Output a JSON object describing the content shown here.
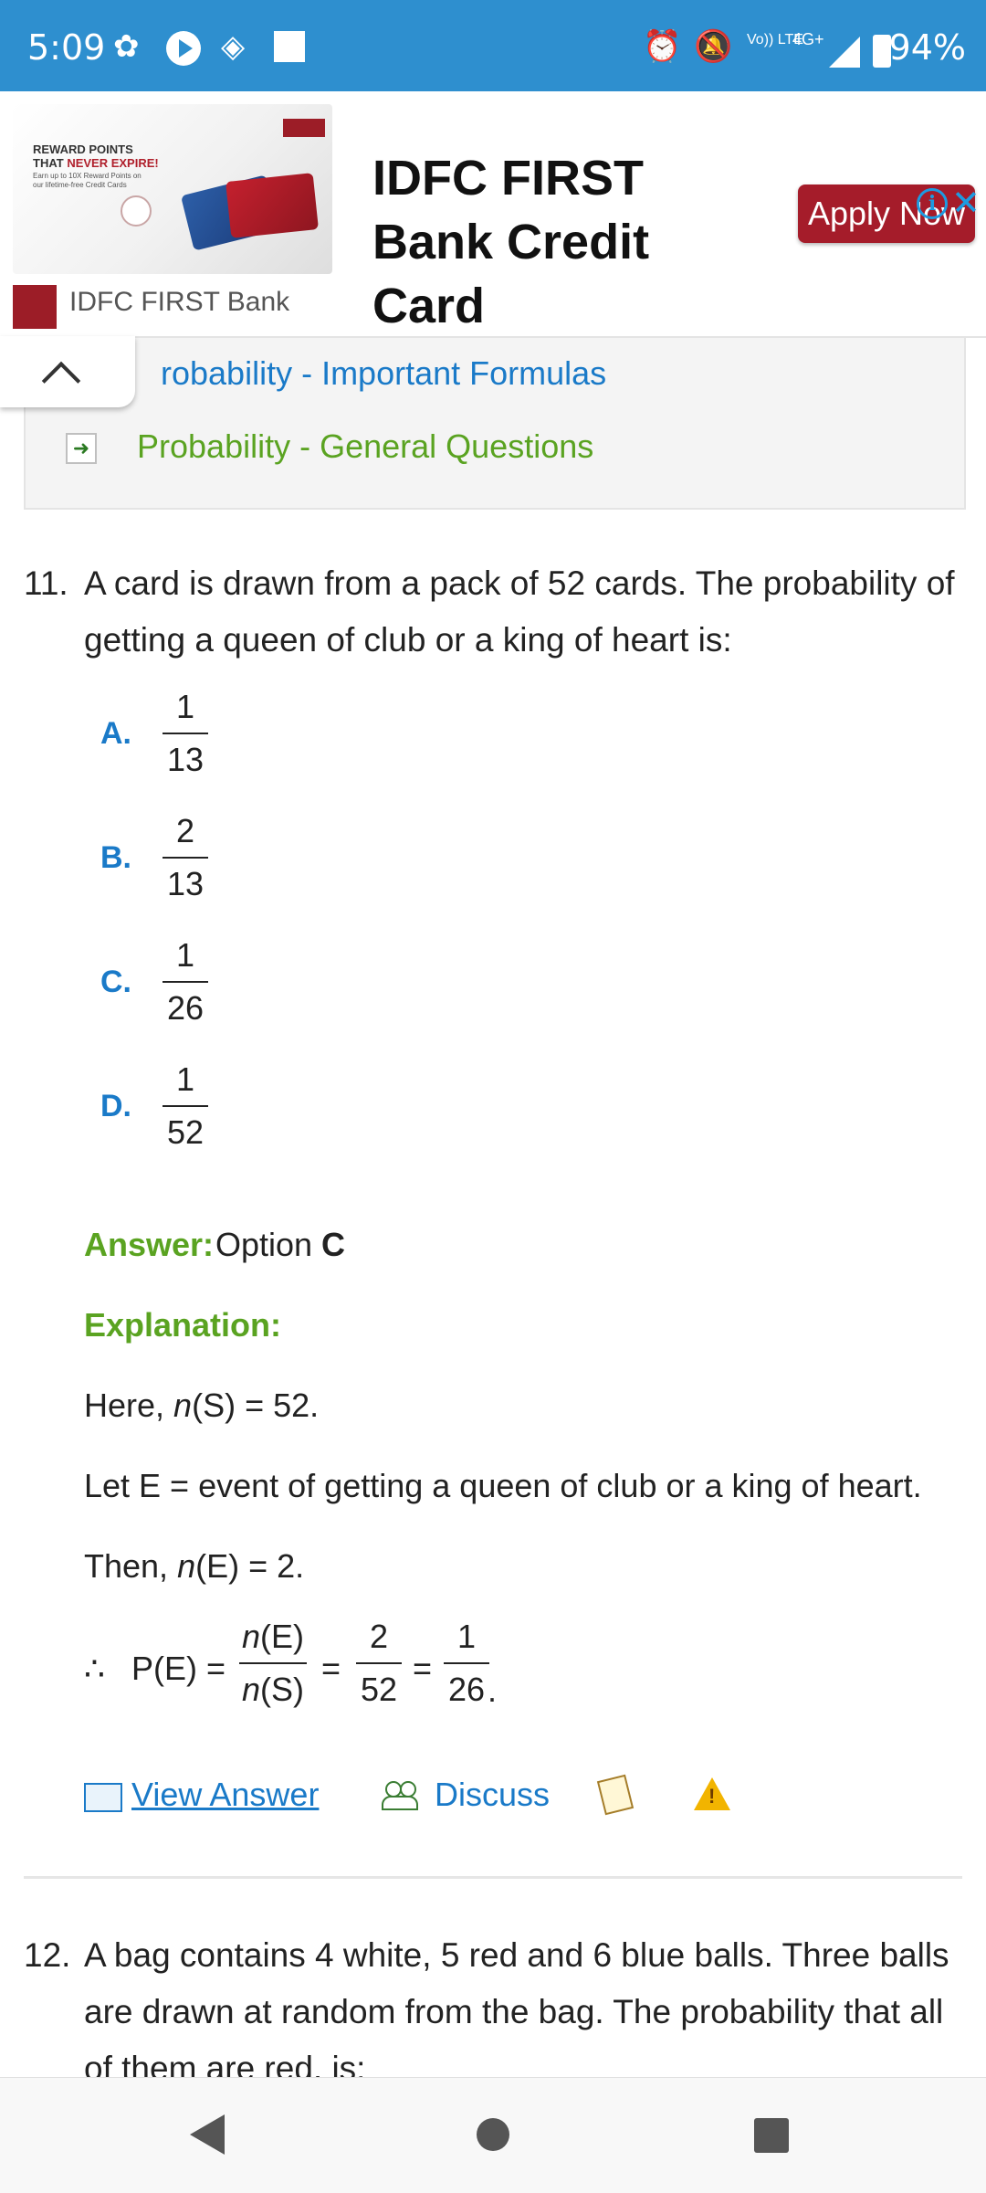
{
  "status_bar": {
    "time": "5:09",
    "battery": "94%",
    "network": "4G+",
    "volte": "Vo)) LTE",
    "icons": [
      "notification-app-icon",
      "play-icon",
      "ticket-icon",
      "square-icon",
      "alarm-icon",
      "mute-icon",
      "volte-icon",
      "signal-icon",
      "battery-icon"
    ]
  },
  "ad": {
    "image_headline_1": "REWARD POINTS",
    "image_headline_2": "THAT ",
    "image_headline_red": "NEVER EXPIRE!",
    "image_subtext": "Earn up to 10X Reward Points on our lifetime-free Credit Cards",
    "title": "IDFC FIRST Bank Credit Card",
    "cta": "Apply Now",
    "brand": "IDFC FIRST Bank",
    "info_glyph": "i",
    "close_glyph": "✕"
  },
  "topics": {
    "item1": "robability - Important Formulas",
    "item2": "Probability - General Questions"
  },
  "question11": {
    "number": "11.",
    "text": "A card is drawn from a pack of 52 cards. The probability of getting a queen of club or a king of heart is:",
    "options": [
      {
        "letter": "A.",
        "num": "1",
        "den": "13"
      },
      {
        "letter": "B.",
        "num": "2",
        "den": "13"
      },
      {
        "letter": "C.",
        "num": "1",
        "den": "26"
      },
      {
        "letter": "D.",
        "num": "1",
        "den": "52"
      }
    ],
    "answer_label": "Answer:",
    "answer_text": "Option",
    "answer_value": "C",
    "explanation_label": "Explanation:",
    "line1_pre": "Here, ",
    "line1_n": "n",
    "line1_post": "(S) = 52.",
    "line2": "Let E = event of getting a queen of club or a king of heart.",
    "line3_pre": "Then, ",
    "line3_n": "n",
    "line3_post": "(E) = 2.",
    "therefore": "∴",
    "pe": "P(E) =",
    "frac1_num": "(E)",
    "frac1_den": "(S)",
    "n_italic": "n",
    "eq": "=",
    "frac2_num": "2",
    "frac2_den": "52",
    "frac3_num": "1",
    "frac3_den": "26",
    "period": "."
  },
  "actions": {
    "view_answer": "View Answer",
    "discuss": "Discuss"
  },
  "question12": {
    "number": "12.",
    "text": "A bag contains 4 white, 5 red and 6 blue balls. Three balls are drawn at random from the bag. The probability that all of them are red, is:"
  }
}
